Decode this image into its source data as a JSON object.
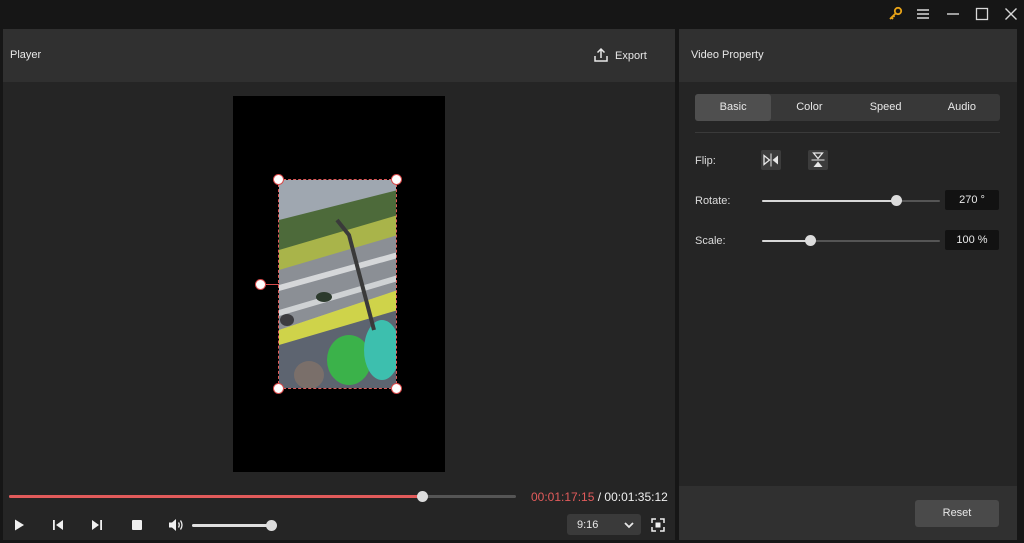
{
  "player": {
    "title": "Player",
    "export_label": "Export",
    "progress_fraction": 0.815,
    "current_time": "00:01:17:15",
    "total_time": "/ 00:01:35:12",
    "volume_fraction": 1.0,
    "aspect_ratio": "9:16"
  },
  "property": {
    "title": "Video Property",
    "tabs": [
      {
        "label": "Basic",
        "active": true
      },
      {
        "label": "Color",
        "active": false
      },
      {
        "label": "Speed",
        "active": false
      },
      {
        "label": "Audio",
        "active": false
      }
    ],
    "flip_label": "Flip:",
    "rotate": {
      "label": "Rotate:",
      "value": "270 °",
      "fraction": 0.75
    },
    "scale": {
      "label": "Scale:",
      "value": "100 %",
      "fraction": 0.27
    },
    "reset_label": "Reset"
  },
  "icons": {
    "titlebar": [
      "key-icon",
      "menu-icon",
      "minimize-icon",
      "maximize-icon",
      "close-icon"
    ],
    "controls": [
      "play-icon",
      "previous-frame-icon",
      "next-frame-icon",
      "stop-icon",
      "volume-icon",
      "fullscreen-icon"
    ]
  },
  "colors": {
    "accent": "#e25b5b",
    "key_icon": "#e8a317",
    "panel": "#252525",
    "header": "#303030"
  }
}
